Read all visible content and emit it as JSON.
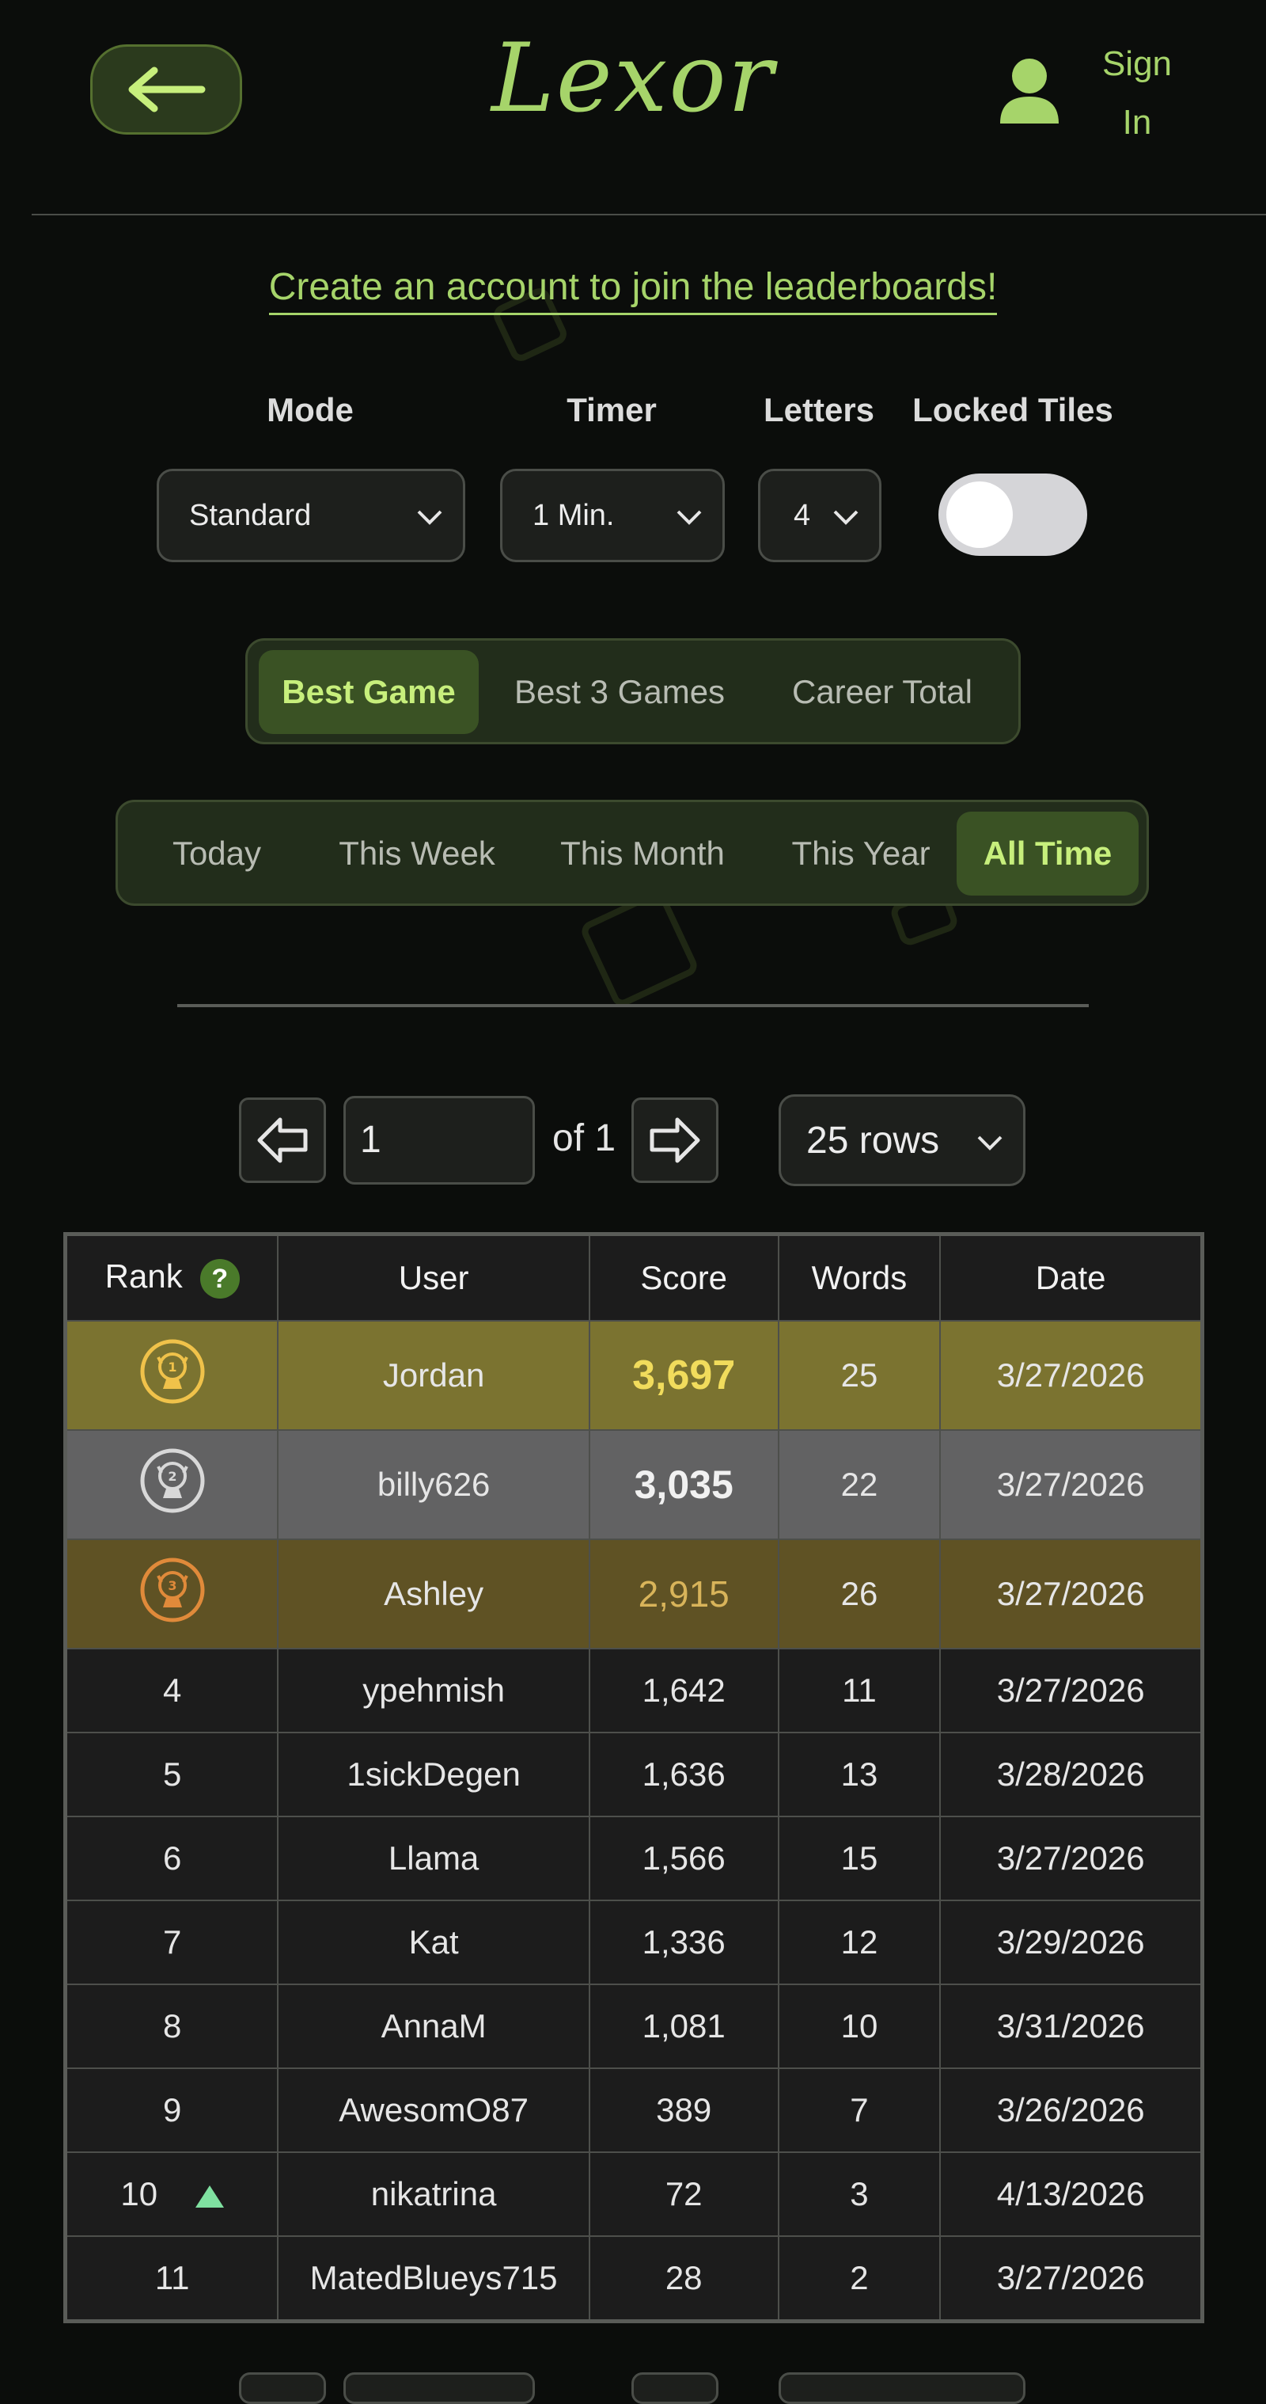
{
  "app": {
    "logo": "Lexor",
    "sign_in": "Sign In"
  },
  "banner": {
    "create_account": "Create an account to join the leaderboards!"
  },
  "filters": {
    "mode": {
      "label": "Mode",
      "value": "Standard"
    },
    "timer": {
      "label": "Timer",
      "value": "1 Min."
    },
    "letters": {
      "label": "Letters",
      "value": "4"
    },
    "locked_tiles": {
      "label": "Locked Tiles",
      "enabled": false
    }
  },
  "score_type_tabs": [
    {
      "label": "Best Game",
      "active": true
    },
    {
      "label": "Best 3 Games",
      "active": false
    },
    {
      "label": "Career Total",
      "active": false
    }
  ],
  "period_tabs": [
    {
      "label": "Today",
      "active": false
    },
    {
      "label": "This Week",
      "active": false
    },
    {
      "label": "This Month",
      "active": false
    },
    {
      "label": "This Year",
      "active": false
    },
    {
      "label": "All Time",
      "active": true
    }
  ],
  "pagination": {
    "page": "1",
    "of_text": "of 1",
    "rows": "25 rows"
  },
  "table": {
    "headers": {
      "rank": "Rank",
      "rank_help": "?",
      "user": "User",
      "score": "Score",
      "words": "Words",
      "date": "Date"
    },
    "rows": [
      {
        "rank": "1",
        "user": "Jordan",
        "score": "3,697",
        "words": "25",
        "date": "3/27/2026"
      },
      {
        "rank": "2",
        "user": "billy626",
        "score": "3,035",
        "words": "22",
        "date": "3/27/2026"
      },
      {
        "rank": "3",
        "user": "Ashley",
        "score": "2,915",
        "words": "26",
        "date": "3/27/2026"
      },
      {
        "rank": "4",
        "user": "ypehmish",
        "score": "1,642",
        "words": "11",
        "date": "3/27/2026"
      },
      {
        "rank": "5",
        "user": "1sickDegen",
        "score": "1,636",
        "words": "13",
        "date": "3/28/2026"
      },
      {
        "rank": "6",
        "user": "Llama",
        "score": "1,566",
        "words": "15",
        "date": "3/27/2026"
      },
      {
        "rank": "7",
        "user": "Kat",
        "score": "1,336",
        "words": "12",
        "date": "3/29/2026"
      },
      {
        "rank": "8",
        "user": "AnnaM",
        "score": "1,081",
        "words": "10",
        "date": "3/31/2026"
      },
      {
        "rank": "9",
        "user": "AwesomO87",
        "score": "389",
        "words": "7",
        "date": "3/26/2026"
      },
      {
        "rank": "10",
        "user": "nikatrina",
        "score": "72",
        "words": "3",
        "date": "4/13/2026"
      },
      {
        "rank": "11",
        "user": "MatedBlueys715",
        "score": "28",
        "words": "2",
        "date": "3/27/2026"
      }
    ]
  },
  "colors": {
    "accent": "#a6d46a",
    "gold": "#7b7330",
    "silver": "#626263",
    "bronze": "#5f5224"
  }
}
